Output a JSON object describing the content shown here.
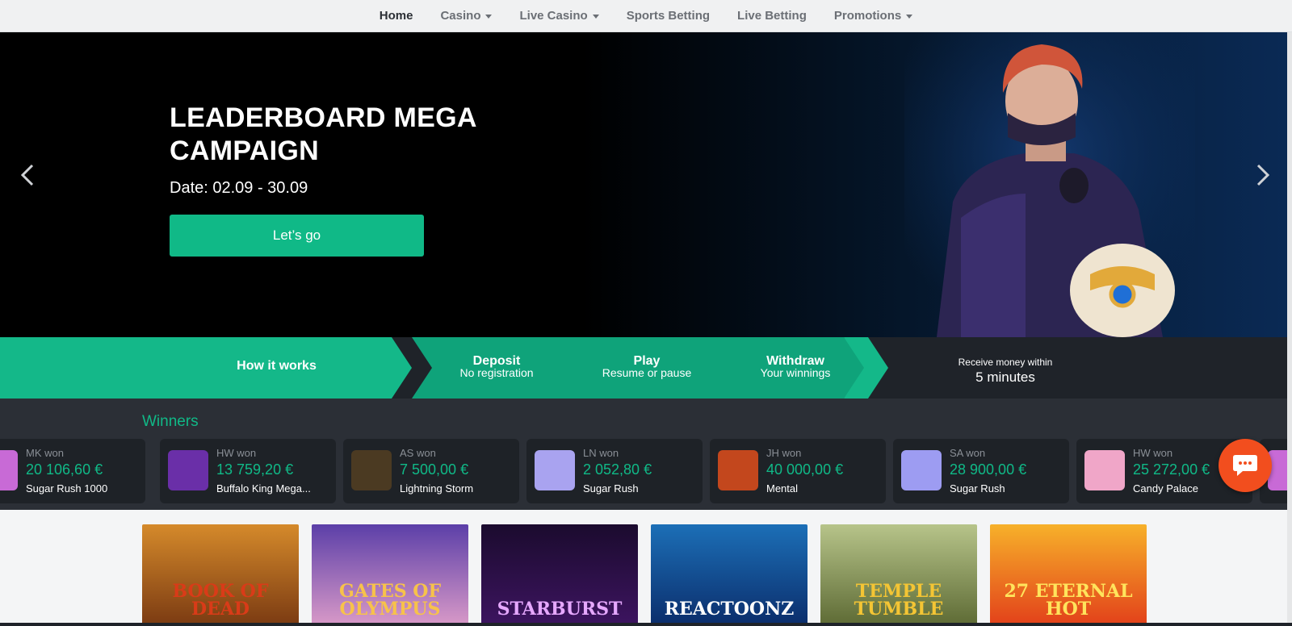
{
  "nav": {
    "items": [
      {
        "label": "Home",
        "active": true,
        "dropdown": false
      },
      {
        "label": "Casino",
        "active": false,
        "dropdown": true
      },
      {
        "label": "Live Casino",
        "active": false,
        "dropdown": true
      },
      {
        "label": "Sports Betting",
        "active": false,
        "dropdown": false
      },
      {
        "label": "Live Betting",
        "active": false,
        "dropdown": false
      },
      {
        "label": "Promotions",
        "active": false,
        "dropdown": true
      }
    ]
  },
  "hero": {
    "title": "LEADERBOARD MEGA CAMPAIGN",
    "date": "Date: 02.09 - 30.09",
    "cta": "Let’s go"
  },
  "steps": {
    "how": "How it works",
    "items": [
      {
        "title": "Deposit",
        "subtitle": "No registration"
      },
      {
        "title": "Play",
        "subtitle": "Resume or pause"
      },
      {
        "title": "Withdraw",
        "subtitle": "Your winnings"
      }
    ],
    "receive_label": "Receive money within",
    "receive_value": "5 minutes"
  },
  "winners": {
    "title": "Winners",
    "items": [
      {
        "who": "MK won",
        "amount": "20 106,60 €",
        "game": "Sugar Rush 1000",
        "color": "#c86ad6"
      },
      {
        "who": "HW won",
        "amount": "13 759,20 €",
        "game": "Buffalo King Mega...",
        "color": "#6a2fa8"
      },
      {
        "who": "AS won",
        "amount": "7 500,00 €",
        "game": "Lightning Storm",
        "color": "#4b3a22"
      },
      {
        "who": "LN won",
        "amount": "2 052,80 €",
        "game": "Sugar Rush",
        "color": "#a9a3f0"
      },
      {
        "who": "JH won",
        "amount": "40 000,00 €",
        "game": "Mental",
        "color": "#c3471d"
      },
      {
        "who": "SA won",
        "amount": "28 900,00 €",
        "game": "Sugar Rush",
        "color": "#9d9cf2"
      },
      {
        "who": "HW won",
        "amount": "25 272,00 €",
        "game": "Candy Palace",
        "color": "#f0a6c8"
      }
    ]
  },
  "games": [
    {
      "name": "BOOK OF DEAD",
      "bg": "linear-gradient(180deg,#d58a2b,#7a3a12)",
      "fg": "#d93b18"
    },
    {
      "name": "GATES OF OLYMPUS",
      "bg": "linear-gradient(180deg,#5b3fa8,#d99ac8)",
      "fg": "#f7c24a"
    },
    {
      "name": "STARBURST",
      "bg": "linear-gradient(180deg,#1b0b2e,#3d1460)",
      "fg": "#e6a8ff"
    },
    {
      "name": "REACTOONZ",
      "bg": "linear-gradient(180deg,#1c6fb7,#0b2d6b)",
      "fg": "#ffffff"
    },
    {
      "name": "TEMPLE TUMBLE",
      "bg": "linear-gradient(180deg,#b7c48a,#5d6a34)",
      "fg": "#f4c534"
    },
    {
      "name": "27 ETERNAL HOT",
      "bg": "linear-gradient(180deg,#f7b12a,#e2401a)",
      "fg": "#ffe45c"
    }
  ],
  "colors": {
    "accent": "#10b987",
    "chat": "#f24e1e",
    "dark": "#1f2329"
  }
}
